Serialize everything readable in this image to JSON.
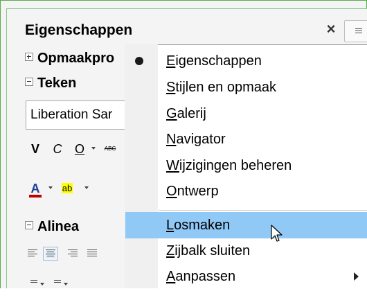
{
  "sidebar": {
    "title": "Eigenschappen",
    "close_glyph": "×",
    "sections": [
      {
        "label": "Opmaakprofielen",
        "visible_label": "Opmaakpro",
        "expanded": false
      },
      {
        "label": "Teken",
        "expanded": true
      },
      {
        "label": "Alinea",
        "expanded": true
      }
    ],
    "font_name": "Liberation Sans",
    "font_name_visible": "Liberation Sar",
    "char_toolbar": {
      "bold": "V",
      "italic": "C",
      "underline": "O",
      "strike": "ABC",
      "font_color_glyph": "A",
      "highlight_glyph": "ab",
      "font_color": "#c00000",
      "highlight_color": "#ffff00"
    }
  },
  "context_menu": {
    "items": [
      {
        "label": "Eigenschappen",
        "mnemonic": "E",
        "rest": "igenschappen",
        "selected_bullet": true
      },
      {
        "label": "Stijlen en opmaak",
        "mnemonic": "S",
        "rest": "tijlen en opmaak"
      },
      {
        "label": "Galerij",
        "mnemonic": "G",
        "rest": "alerij"
      },
      {
        "label": "Navigator",
        "mnemonic": "N",
        "rest": "avigator"
      },
      {
        "label": "Wijzigingen beheren",
        "mnemonic": "W",
        "rest": "ijzigingen beheren"
      },
      {
        "label": "Ontwerp",
        "mnemonic": "O",
        "rest": "ntwerp"
      },
      {
        "label": "Losmaken",
        "mnemonic": "L",
        "rest": "osmaken",
        "highlighted": true
      },
      {
        "label": "Zijbalk sluiten",
        "mnemonic": "Z",
        "rest": "ijbalk sluiten"
      },
      {
        "label": "Aanpassen",
        "mnemonic": "A",
        "rest": "anpassen",
        "has_submenu": true
      }
    ]
  },
  "colors": {
    "window_border": "#59a94a",
    "menu_highlight": "#90c8f6",
    "panel_bg": "#f4f4f4"
  }
}
